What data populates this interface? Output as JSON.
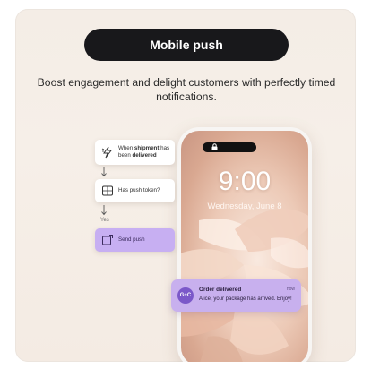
{
  "header": {
    "title": "Mobile push",
    "subtitle": "Boost engagement and delight customers with perfectly timed notifications."
  },
  "phone": {
    "time": "9:00",
    "date": "Wednesday, June 8"
  },
  "notification": {
    "avatar": "G+C",
    "title": "Order delivered",
    "time": "now",
    "body": "Alice, your package has arrived. Enjoy!"
  },
  "workflow": {
    "trigger": {
      "prefix": "When ",
      "bold1": "shipment",
      "mid": " has been ",
      "bold2": "delivered",
      "icon": "lightning-icon"
    },
    "condition": {
      "label": "Has push token?",
      "icon": "branch-icon"
    },
    "branch_label": "Yes",
    "action": {
      "label": "Send push",
      "icon": "push-icon"
    }
  },
  "colors": {
    "pill": "#18181b",
    "accent_purple": "#c7aff2",
    "background": "#f4ede6"
  }
}
